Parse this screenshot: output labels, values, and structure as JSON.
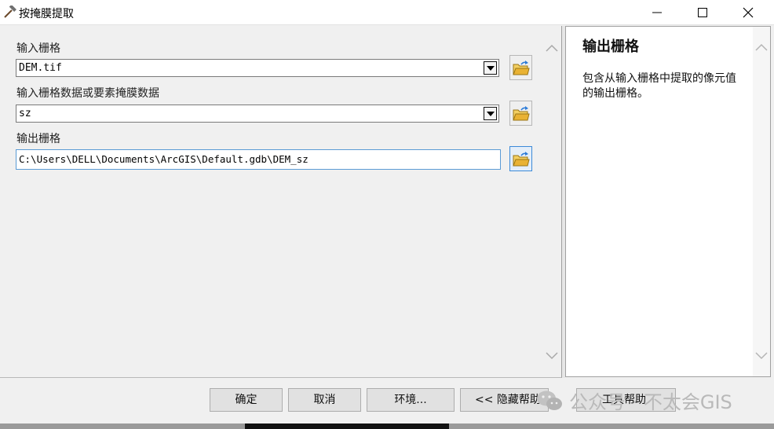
{
  "window": {
    "title": "按掩膜提取"
  },
  "form": {
    "input_raster_label": "输入栅格",
    "input_raster_value": "DEM.tif",
    "mask_label": "输入栅格数据或要素掩膜数据",
    "mask_value": "sz",
    "output_raster_label": "输出栅格",
    "output_raster_value": "C:\\Users\\DELL\\Documents\\ArcGIS\\Default.gdb\\DEM_sz"
  },
  "help": {
    "title": "输出栅格",
    "text": "包含从输入栅格中提取的像元值的输出栅格。"
  },
  "buttons": {
    "ok": "确定",
    "cancel": "取消",
    "environments": "环境...",
    "hide_help": "<< 隐藏帮助",
    "tool_help": "工具帮助"
  },
  "watermark": {
    "text": "公众号 · 不太会GIS"
  },
  "icons": {
    "app": "hammer-icon",
    "folder": "open-folder-icon",
    "minimize": "minimize-icon",
    "maximize": "maximize-icon",
    "close": "close-icon",
    "dropdown": "chevron-down-icon",
    "scroll_up": "chevron-up-icon",
    "scroll_down": "chevron-down-icon",
    "watermark": "wechat-icon"
  },
  "colors": {
    "focus_border": "#5b9bd5",
    "folder_yellow": "#e9b233",
    "folder_arrow": "#2c7bd8"
  }
}
